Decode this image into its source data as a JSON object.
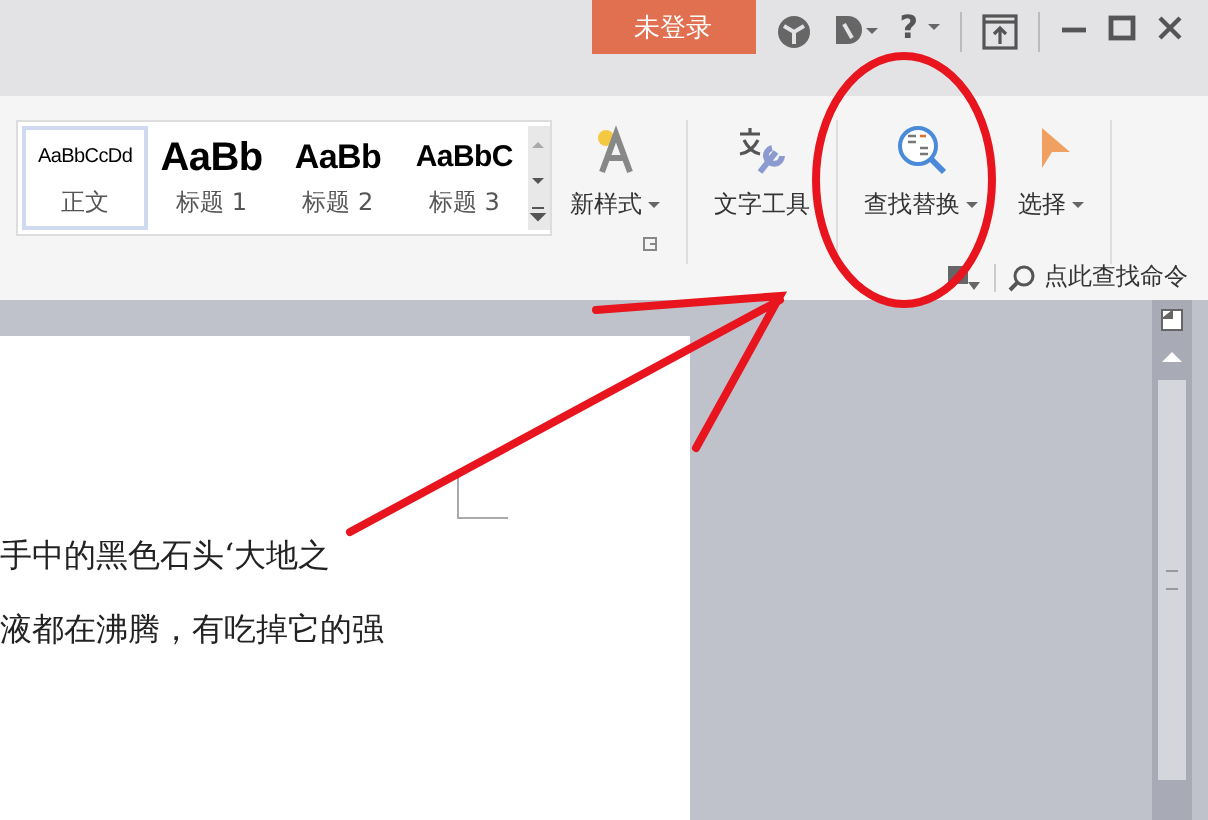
{
  "title_bar": {
    "login_button": "未登录",
    "help_label": "?"
  },
  "ribbon": {
    "styles": [
      {
        "sample": "AaBbCcDd",
        "label": "正文",
        "kind": "body",
        "selected": true
      },
      {
        "sample": "AaBb",
        "label": "标题 1",
        "kind": "h1",
        "selected": false
      },
      {
        "sample": "AaBb",
        "label": "标题 2",
        "kind": "h2",
        "selected": false
      },
      {
        "sample": "AaBbC",
        "label": "标题 3",
        "kind": "h3",
        "selected": false
      }
    ],
    "buttons": [
      {
        "label": "新样式",
        "kind": "new-style"
      },
      {
        "label": "文字工具",
        "kind": "text-tools"
      },
      {
        "label": "查找替换",
        "kind": "find-replace"
      },
      {
        "label": "选择",
        "kind": "select"
      }
    ],
    "search_command": "点此查找命令"
  },
  "document": {
    "lines": [
      "手中的黑色石头‘大地之",
      "液都在沸腾，有吃掉它的强"
    ]
  }
}
